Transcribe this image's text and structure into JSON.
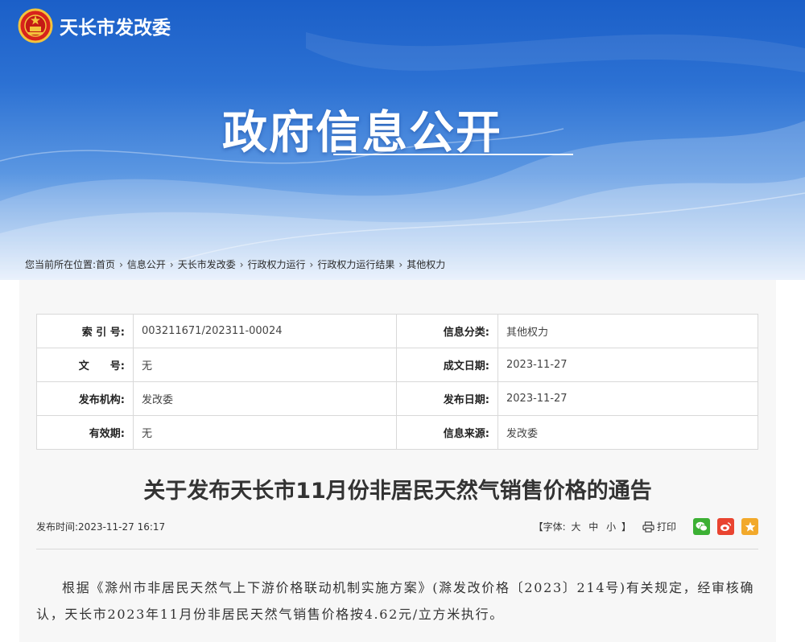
{
  "header": {
    "site_name": "天长市发改委",
    "hero_title": "政府信息公开"
  },
  "breadcrumb": {
    "prefix": "您当前所在位置:",
    "items": [
      "首页",
      "信息公开",
      "天长市发改委",
      "行政权力运行",
      "行政权力运行结果",
      "其他权力"
    ],
    "separator": "›"
  },
  "meta": {
    "index_no_label": "索 引 号:",
    "index_no": "003211671/202311-00024",
    "category_label": "信息分类:",
    "category": "其他权力",
    "doc_no_label": "文　　号:",
    "doc_no": "无",
    "created_label": "成文日期:",
    "created": "2023-11-27",
    "publisher_label": "发布机构:",
    "publisher": "发改委",
    "published_label": "发布日期:",
    "published": "2023-11-27",
    "validity_label": "有效期:",
    "validity": "无",
    "source_label": "信息来源:",
    "source": "发改委"
  },
  "article": {
    "title": "关于发布天长市11月份非居民天然气销售价格的通告",
    "pub_time_label": "发布时间:",
    "pub_time": "2023-11-27 16:17",
    "font_label": "【字体:",
    "font_large": "大",
    "font_medium": "中",
    "font_small": "小",
    "font_end": "】",
    "print_label": "打印",
    "body": "根据《滁州市非居民天然气上下游价格联动机制实施方案》(滁发改价格〔2023〕214号)有关规定，经审核确认，天长市2023年11月份非居民天然气销售价格按4.62元/立方米执行。"
  },
  "colors": {
    "banner_top": "#1b5fc8",
    "wechat": "#3cb034",
    "weibo": "#e94430",
    "qzone": "#f2a92b"
  }
}
